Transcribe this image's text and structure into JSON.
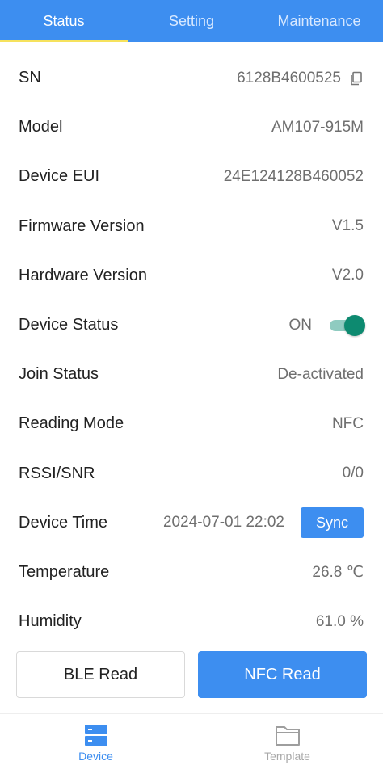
{
  "tabs": [
    {
      "label": "Status",
      "active": true
    },
    {
      "label": "Setting",
      "active": false
    },
    {
      "label": "Maintenance",
      "active": false
    }
  ],
  "status": {
    "sn": {
      "label": "SN",
      "value": "6128B4600525"
    },
    "model": {
      "label": "Model",
      "value": "AM107-915M"
    },
    "device_eui": {
      "label": "Device EUI",
      "value": "24E124128B460052"
    },
    "firmware": {
      "label": "Firmware Version",
      "value": "V1.5"
    },
    "hardware": {
      "label": "Hardware Version",
      "value": "V2.0"
    },
    "device_status": {
      "label": "Device Status",
      "value": "ON",
      "enabled": true
    },
    "join_status": {
      "label": "Join Status",
      "value": "De-activated"
    },
    "reading_mode": {
      "label": "Reading Mode",
      "value": "NFC"
    },
    "rssi_snr": {
      "label": "RSSI/SNR",
      "value": "0/0"
    },
    "device_time": {
      "label": "Device Time",
      "value": "2024-07-01 22:02",
      "sync_label": "Sync"
    },
    "temperature": {
      "label": "Temperature",
      "value": "26.8 ℃"
    },
    "humidity": {
      "label": "Humidity",
      "value": "61.0 %"
    }
  },
  "actions": {
    "ble_read": "BLE Read",
    "nfc_read": "NFC Read"
  },
  "bottom_nav": [
    {
      "label": "Device",
      "icon": "device-icon",
      "active": true
    },
    {
      "label": "Template",
      "icon": "folder-icon",
      "active": false
    }
  ],
  "colors": {
    "primary": "#3d8ef0",
    "tab_indicator": "#f6e25d",
    "toggle_on": "#0d8a70"
  }
}
